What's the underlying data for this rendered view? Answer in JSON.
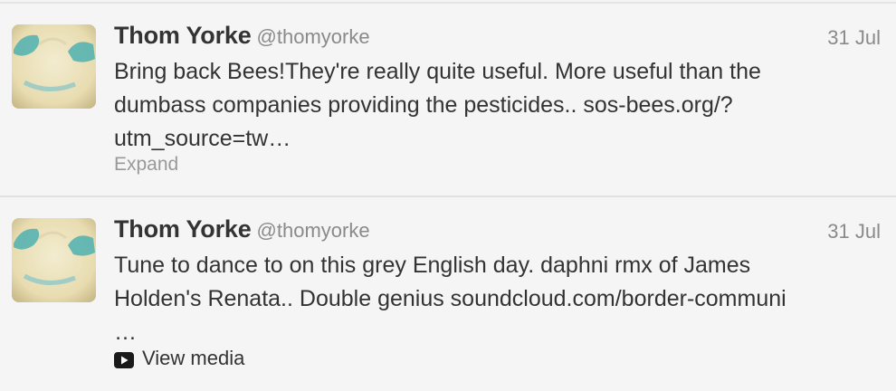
{
  "tweets": [
    {
      "name": "Thom Yorke",
      "handle": "@thomyorke",
      "date": "31 Jul",
      "text_lines": [
        "Bring back Bees!They're really quite useful. More useful than the",
        "dumbass companies providing the pesticides.. sos-bees.org/?",
        "utm_source=tw…"
      ],
      "action_label": "Expand",
      "avatar_icon": "avatar-image"
    },
    {
      "name": "Thom Yorke",
      "handle": "@thomyorke",
      "date": "31 Jul",
      "text_lines": [
        "Tune to dance to on this grey English day. daphni rmx of James",
        "Holden's Renata.. Double genius  soundcloud.com/border-communi",
        "…"
      ],
      "action_label": "View media",
      "action_icon": "play-icon",
      "avatar_icon": "avatar-image"
    }
  ],
  "colors": {
    "background": "#f5f5f5",
    "name": "#333333",
    "meta": "#8a8a8a",
    "expand": "#999999",
    "divider": "#e1e1e1"
  }
}
